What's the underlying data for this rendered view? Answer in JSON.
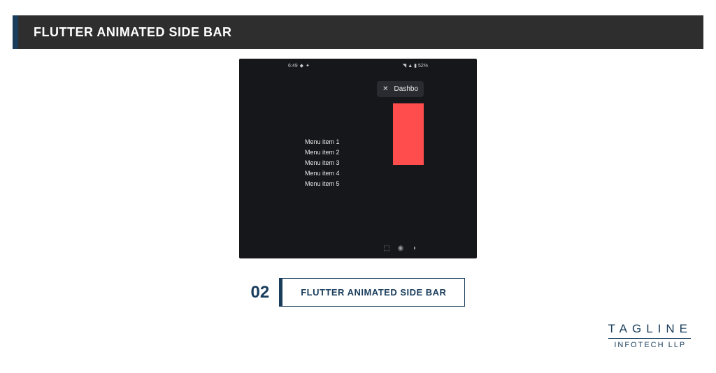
{
  "header": {
    "title": "FLUTTER ANIMATED SIDE BAR"
  },
  "demo": {
    "status": {
      "time": "6:49",
      "battery": "52%"
    },
    "appbar": {
      "close": "✕",
      "title": "Dashbo"
    },
    "menu": [
      "Menu item 1",
      "Menu item 2",
      "Menu item 3",
      "Menu item 4",
      "Menu item 5"
    ]
  },
  "caption": {
    "number": "02",
    "text": "FLUTTER ANIMATED SIDE BAR"
  },
  "logo": {
    "top": "TAGLINE",
    "bottom": "INFOTECH LLP"
  }
}
